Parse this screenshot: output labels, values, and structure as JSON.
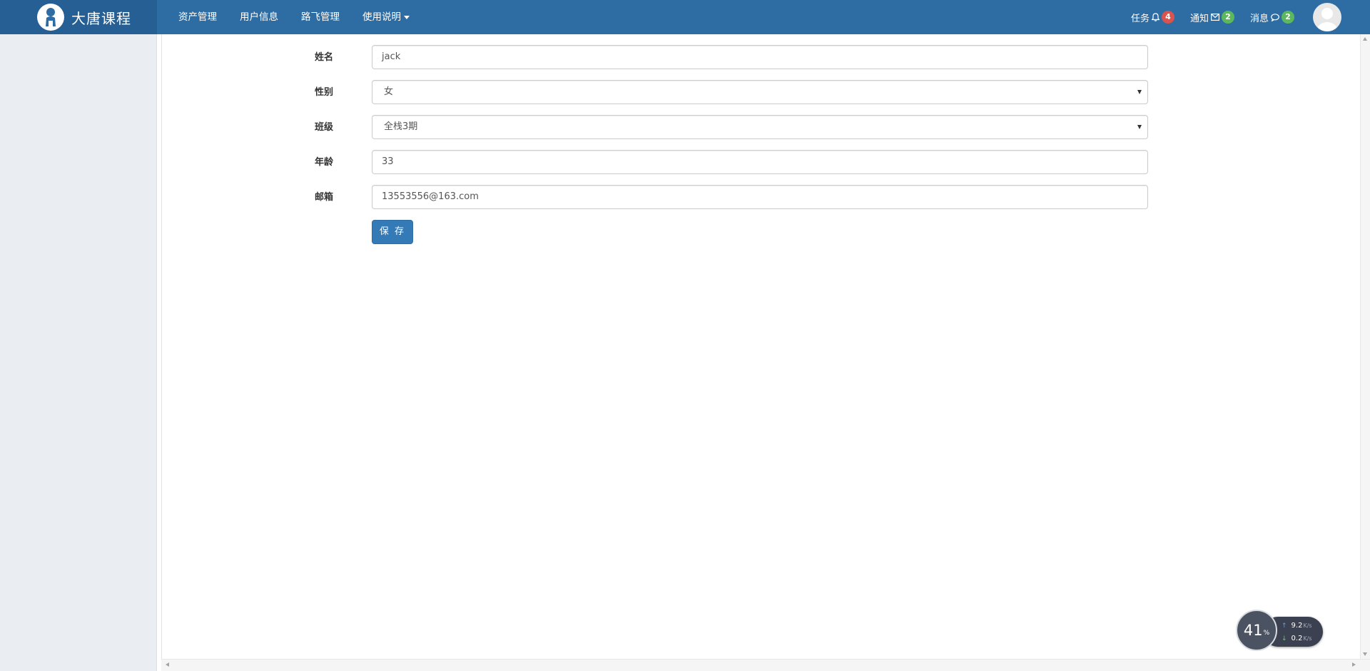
{
  "brand": {
    "title": "大唐课程"
  },
  "nav": {
    "items": [
      {
        "label": "资产管理"
      },
      {
        "label": "用户信息"
      },
      {
        "label": "路飞管理"
      },
      {
        "label": "使用说明"
      }
    ],
    "right": {
      "tasks": {
        "label": "任务",
        "count": "4",
        "icon": "bell-icon",
        "color": "#d9534f"
      },
      "notices": {
        "label": "通知",
        "count": "2",
        "icon": "envelope-icon",
        "color": "#5cb85c"
      },
      "messages": {
        "label": "消息",
        "count": "2",
        "icon": "comment-icon",
        "color": "#5cb85c"
      }
    }
  },
  "form": {
    "name": {
      "label": "姓名",
      "value": "jack"
    },
    "gender": {
      "label": "性别",
      "value": "女"
    },
    "class": {
      "label": "班级",
      "value": "全栈3期"
    },
    "age": {
      "label": "年龄",
      "value": "33"
    },
    "email": {
      "label": "邮箱",
      "value": "13553556@163.com"
    },
    "save_label": "保 存"
  },
  "net_widget": {
    "percent": "41",
    "percent_sign": "%",
    "upload": "9.2",
    "download": "0.2",
    "unit": "K/s"
  },
  "colors": {
    "navbar": "#2e6da4",
    "primary_button": "#337ab7",
    "sidebar": "#eaedf2"
  }
}
